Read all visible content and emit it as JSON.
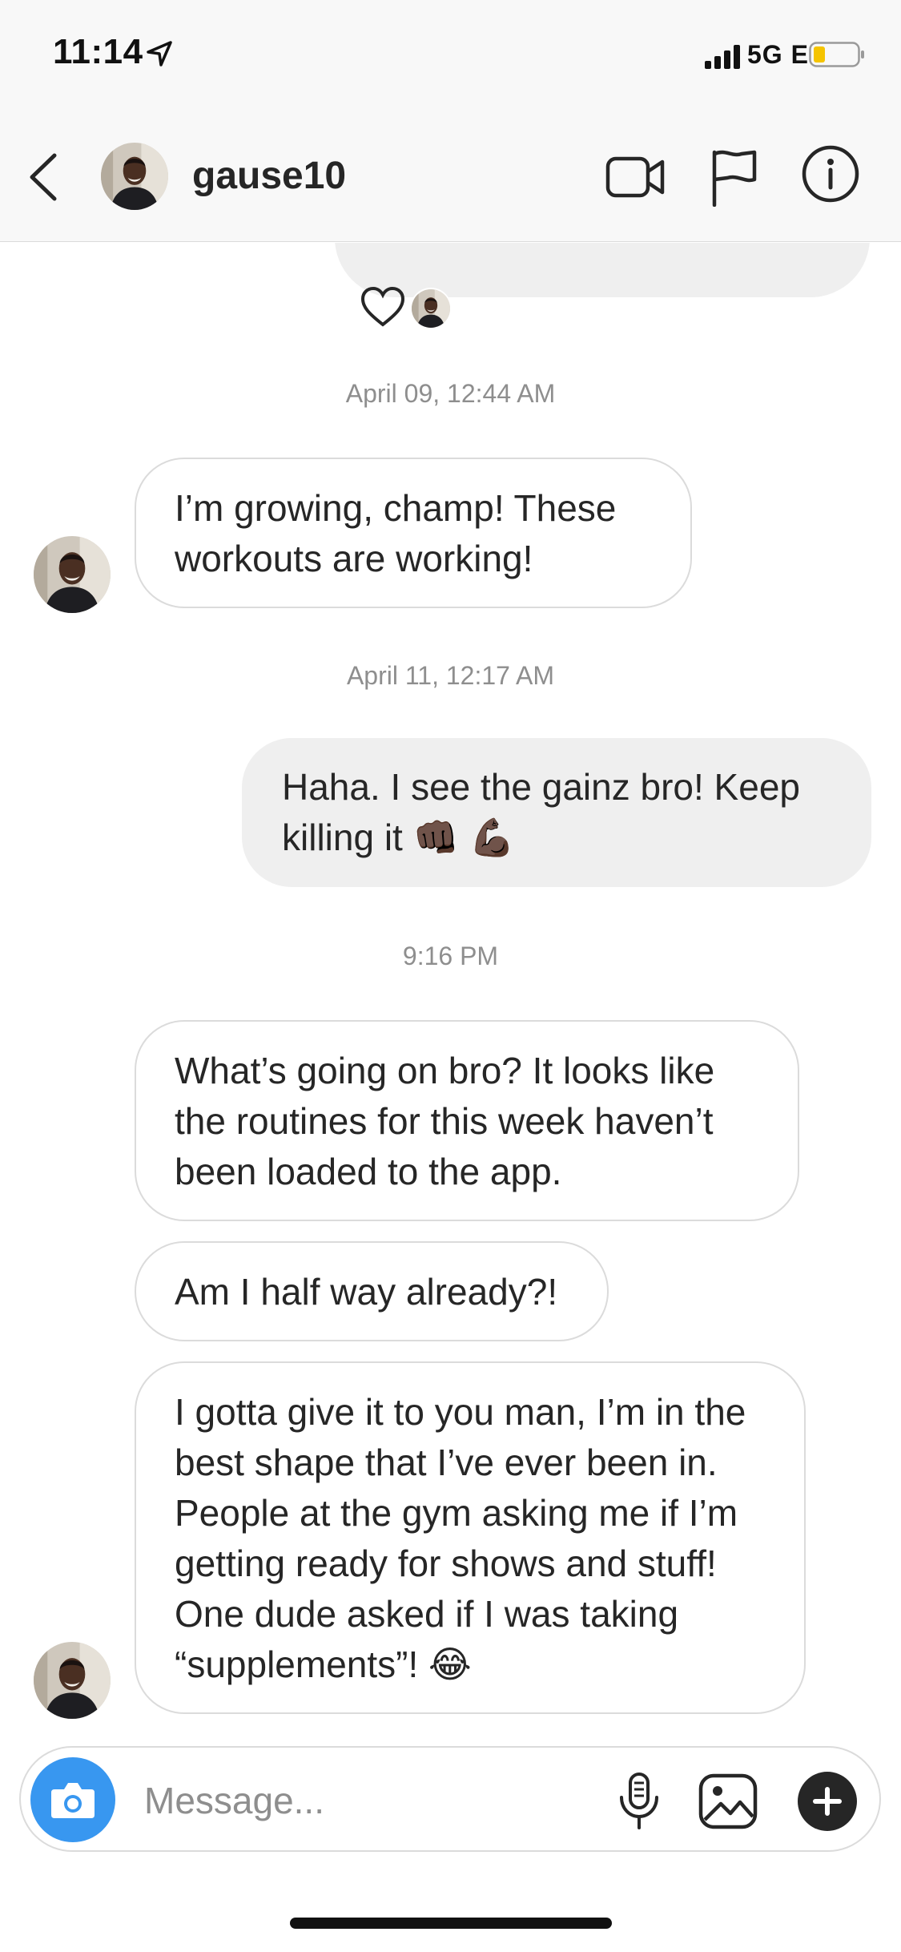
{
  "status_bar": {
    "time": "11:14",
    "network": "5G E",
    "icons": [
      "location-arrow-icon",
      "signal-bars-icon",
      "battery-icon"
    ]
  },
  "header": {
    "username": "gause10",
    "icons": [
      "back-chevron-icon",
      "video-camera-icon",
      "flag-icon",
      "info-icon"
    ]
  },
  "messages": [
    {
      "type": "reaction",
      "icons": [
        "heart-icon",
        "avatar"
      ]
    },
    {
      "type": "timestamp",
      "text": "April 09, 12:44 AM"
    },
    {
      "type": "incoming",
      "text": "I’m growing, champ! These workouts are working!"
    },
    {
      "type": "timestamp",
      "text": "April 11, 12:17 AM"
    },
    {
      "type": "outgoing",
      "text": "Haha. I see the gainz bro! Keep killing it 👊🏿 💪🏿"
    },
    {
      "type": "timestamp",
      "text": "9:16 PM"
    },
    {
      "type": "incoming",
      "text": "What’s going on bro? It looks like the routines for this week haven’t been loaded to the app."
    },
    {
      "type": "incoming",
      "text": "Am I half way already?!"
    },
    {
      "type": "incoming",
      "text": "I gotta give it to you man, I’m in the best shape that I’ve ever been in. People at the gym asking me if I’m getting ready for shows and stuff! One dude asked if I was taking “supplements”! 😂"
    }
  ],
  "composer": {
    "placeholder": "Message...",
    "value": "",
    "icons": [
      "camera-icon",
      "microphone-icon",
      "gallery-icon",
      "plus-icon"
    ]
  },
  "colors": {
    "accent": "#3897f0",
    "outgoing_bubble": "#efefef",
    "incoming_border": "#dbdbdb",
    "timestamp": "#8e8e8e",
    "text": "#262626"
  }
}
